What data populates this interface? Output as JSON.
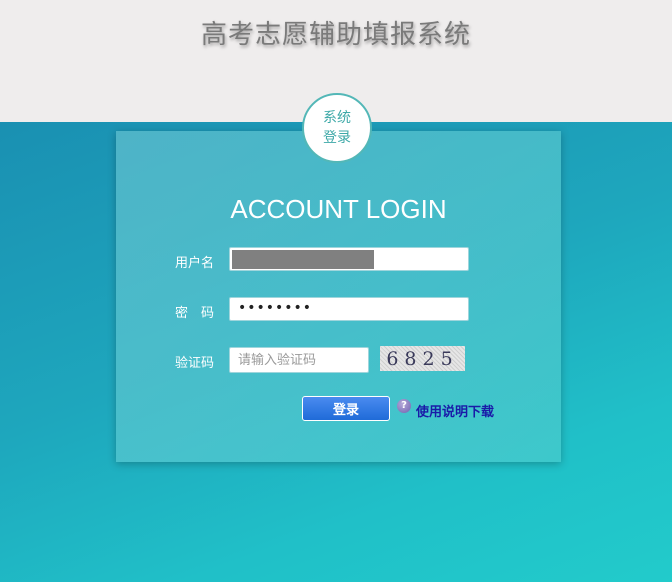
{
  "site": {
    "title": "高考志愿辅助填报系统"
  },
  "badge": {
    "line1": "系统",
    "line2": "登录"
  },
  "login": {
    "heading": "ACCOUNT LOGIN",
    "username_label": "用户名",
    "password_label": "密　码",
    "password_value": "••••••••",
    "captcha_label": "验证码",
    "captcha_placeholder": "请输入验证码",
    "captcha_code": "6825",
    "submit_label": "登录",
    "help_icon_symbol": "?",
    "help_link": "使用说明下载"
  },
  "colors": {
    "top_band": "#efeded",
    "background": "#1ea7bd",
    "button": "#2a78e4",
    "link": "#1a1aa8"
  },
  "icons": {
    "help": "question-circle-icon"
  }
}
